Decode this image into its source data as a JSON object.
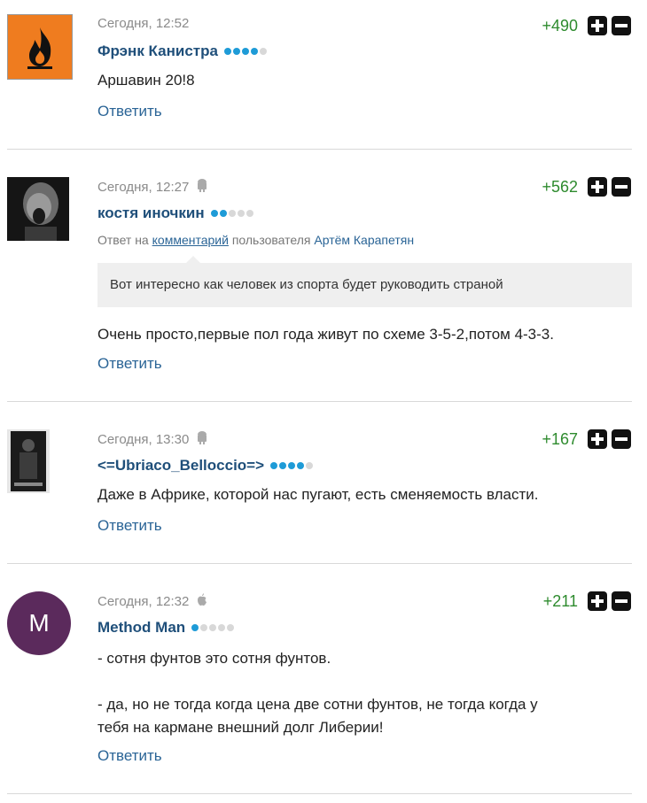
{
  "comments": [
    {
      "time": "Сегодня, 12:52",
      "device": "",
      "author": "Фрэнк Канистра",
      "rank": 4,
      "score": "+490",
      "text": "Аршавин 20!8",
      "reply_label": "Ответить"
    },
    {
      "time": "Сегодня, 12:27",
      "device": "android-icon",
      "author": "костя иночкин",
      "rank": 2,
      "score": "+562",
      "reply_to": {
        "prefix": "Ответ на",
        "link": "комментарий",
        "middle": "пользователя",
        "user": "Артём Карапетян"
      },
      "quote": "Вот интересно как человек из спорта будет руководить страной",
      "text": "Очень просто,первые пол года живут по схеме 3-5-2,потом 4-3-3.",
      "reply_label": "Ответить"
    },
    {
      "time": "Сегодня, 13:30",
      "device": "android-icon",
      "author": "<=Ubriaco_Belloccio=>",
      "rank": 4,
      "score": "+167",
      "text": "Даже в Африке, которой нас пугают, есть сменяемость власти.",
      "reply_label": "Ответить"
    },
    {
      "time": "Сегодня, 12:32",
      "device": "apple-icon",
      "author": "Method Man",
      "avatar_letter": "M",
      "avatar_color": "#5b2a5c",
      "rank": 1,
      "score": "+211",
      "text_lines": [
        "- сотня фунтов это сотня фунтов.",
        "",
        "- да, но не тогда когда цена две сотни фунтов, не тогда когда у",
        "тебя на кармане внешний долг Либерии!"
      ],
      "reply_label": "Ответить"
    }
  ],
  "colors": {
    "author": "#1f4f7a",
    "score": "#2e8b2e",
    "rank_on": "#1e9bd7",
    "rank_off": "#d8d8d8",
    "reply": "#2a6496"
  }
}
